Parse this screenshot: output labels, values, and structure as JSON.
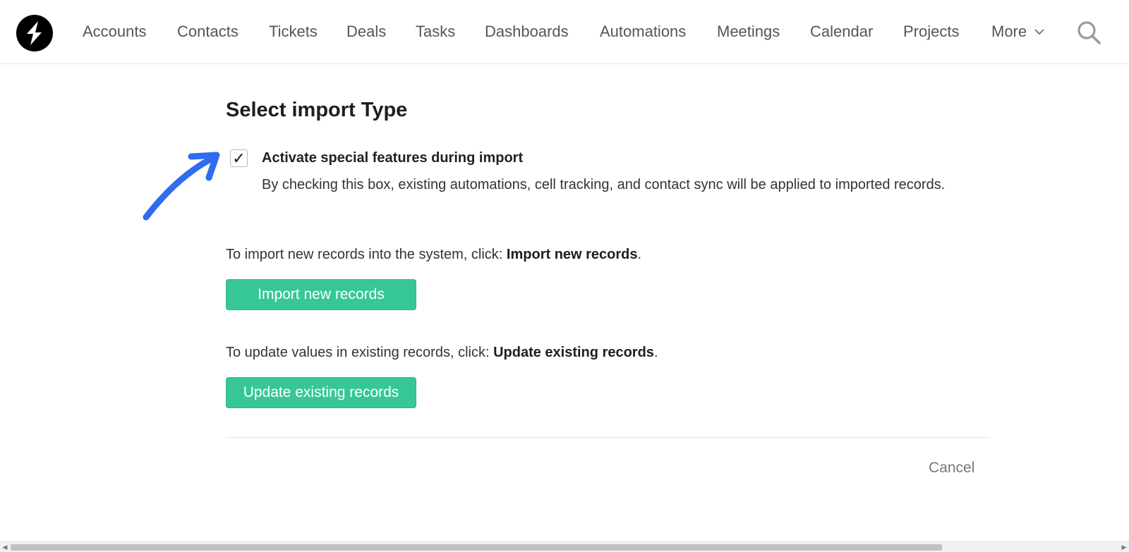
{
  "nav": {
    "items": [
      {
        "label": "Accounts"
      },
      {
        "label": "Contacts"
      },
      {
        "label": "Tickets"
      },
      {
        "label": "Deals"
      },
      {
        "label": "Tasks"
      },
      {
        "label": "Dashboards"
      },
      {
        "label": "Automations"
      },
      {
        "label": "Meetings"
      },
      {
        "label": "Calendar"
      },
      {
        "label": "Projects"
      }
    ],
    "more_label": "More",
    "search_icon": "search-icon",
    "logo_icon": "lightning-bolt-logo"
  },
  "page": {
    "title": "Select import Type",
    "checkbox": {
      "checked": true,
      "check_glyph": "✓",
      "label": "Activate special features during import",
      "description": "By checking this box, existing automations, cell tracking, and contact sync will be applied to imported records."
    },
    "import_new": {
      "text_prefix": "To import new records into the system, click: ",
      "text_bold": "Import new records",
      "text_suffix": ".",
      "button_label": "Import new records"
    },
    "update_existing": {
      "text_prefix": "To update values in existing records, click: ",
      "text_bold": "Update existing records",
      "text_suffix": ".",
      "button_label": "Update existing records"
    },
    "cancel_label": "Cancel"
  },
  "colors": {
    "button_green": "#36c794",
    "annotation_arrow": "#2f6cf0"
  }
}
